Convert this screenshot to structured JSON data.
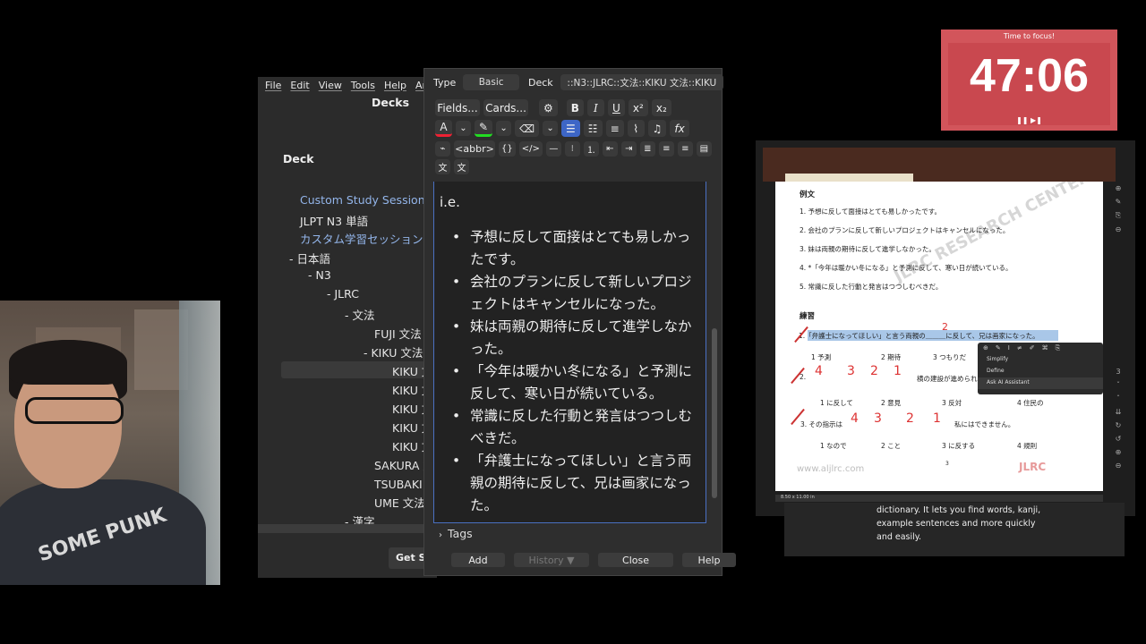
{
  "anki_main": {
    "menu": [
      "File",
      "Edit",
      "View",
      "Tools",
      "Help",
      "Anki"
    ],
    "decks_title": "Decks",
    "deck_header": "Deck",
    "decks": [
      {
        "label": "Custom Study Session",
        "link": true
      },
      {
        "label": "JLPT N3 単語",
        "link": false
      },
      {
        "label": "カスタム学習セッション",
        "link": true
      },
      {
        "label": "-  日本語",
        "link": false
      },
      {
        "label": "-  N3",
        "link": false
      },
      {
        "label": "-  JLRC",
        "link": false
      },
      {
        "label": "-  文法",
        "link": false
      },
      {
        "label": "FUJI 文法",
        "link": false
      },
      {
        "label": "-  KIKU 文法",
        "link": false
      },
      {
        "label": "KIKU 文",
        "link": false
      },
      {
        "label": "KIKU 文",
        "link": false
      },
      {
        "label": "KIKU 文",
        "link": false
      },
      {
        "label": "KIKU 文",
        "link": false
      },
      {
        "label": "KIKU 文",
        "link": false
      },
      {
        "label": "SAKURA 文",
        "link": false
      },
      {
        "label": "TSUBAKI 文",
        "link": false
      },
      {
        "label": "UME 文法",
        "link": false
      },
      {
        "label": "-  漢字",
        "link": false
      }
    ],
    "get_shared": "Get Shared"
  },
  "add_dialog": {
    "type_label": "Type",
    "type_value": "Basic",
    "deck_label": "Deck",
    "deck_value": "::N3::JLRC::文法::KIKU 文法::KIKU",
    "fields_btn": "Fields...",
    "cards_btn": "Cards...",
    "abbr_btn": "<abbr>",
    "editor_heading": "i.e.",
    "examples": [
      "予想に反して面接はとても易しかったです。",
      "会社のプランに反して新しいプロジェクトはキャンセルになった。",
      "妹は両親の期待に反して進学しなかった。",
      "「今年は暖かい冬になる」と予測に反して、寒い日が続いている。",
      "常識に反した行動と発言はつつしむべきだ。",
      "「弁護士になってほしい」と言う両親の期待に反して、兄は画家になった。"
    ],
    "tags_label": "Tags",
    "buttons": {
      "add": "Add",
      "history": "History ▼",
      "close": "Close",
      "help": "Help"
    }
  },
  "timer": {
    "label": "Time to focus!",
    "time": "47:06",
    "controls": "❚❚  ▶❚"
  },
  "pdf": {
    "section1": "例文",
    "lines": [
      "1. 予想に反して面接はとても易しかったです。",
      "2. 会社のプランに反して新しいプロジェクトはキャンセルになった。",
      "3. 妹は両親の期待に反して進学しなかった。",
      "4. *「今年は暖かい冬になる」と予測に反して、寒い日が続いている。",
      "5. 常識に反した行動と発言はつつしむべきだ。"
    ],
    "section2": "練習",
    "q1": "1.「弁護士になってほしい」と言う両親の＿＿＿に反して、兄は画家になった。",
    "q1_opts": [
      "1 予測",
      "2 期待",
      "3 つもりだ"
    ],
    "q2": "2.",
    "q2_tail": "横の建設が進められ",
    "q2_opts": [
      "1 に反して",
      "2 意見",
      "3 反対",
      "4 住民の"
    ],
    "q3": "3. その指示は",
    "q3_tail": "私にはできません。",
    "q3_opts": [
      "1 なので",
      "2 こと",
      "3 に反する",
      "4 規則"
    ],
    "page_number": "3",
    "site": "www.aljlrc.com",
    "logo": "JLRC",
    "watermark": "JLRC RESEARCH CENTER",
    "handwritten": {
      "q1_answer": "2",
      "q2_answers": [
        "4",
        "3",
        "2",
        "1"
      ],
      "q3_answers": [
        "4",
        "3",
        "2",
        "1"
      ]
    },
    "popup_items": [
      "Simplify",
      "Define",
      "Ask AI Assistant"
    ],
    "status_bar": "8.50 x 11.00 in",
    "side_icons": [
      "⊕",
      "✎",
      "⎘",
      "⊖",
      "3",
      "ˇ",
      "ˆ",
      "⇊",
      "↻",
      "↺",
      "⊕",
      "⊖"
    ]
  },
  "tooltip": {
    "text": "dictionary. It lets you find words, kanji, example sentences and more quickly and easily."
  },
  "colors": {
    "accent": "#3d66c7",
    "timer": "#d2555b",
    "link": "#93b5ea"
  },
  "webcam": {
    "shirt_text": "SOME PUNK"
  }
}
